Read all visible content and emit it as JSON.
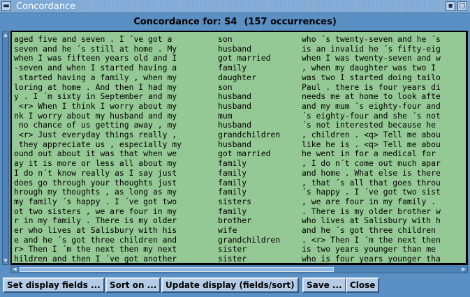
{
  "window": {
    "title": "Concordance"
  },
  "header": {
    "label": "Concordance for: S4",
    "count": "(157 occurrences)"
  },
  "lines": [
    {
      "left": "aged five and seven . I ´ve got a",
      "word": "son",
      "right": "who ´s twenty-seven and he ´s"
    },
    {
      "left": "seven and he ´s still at home . My",
      "word": "husband",
      "right": "is an invalid he ´s fifty-eig"
    },
    {
      "left": "when I was fifteen years old and I",
      "word": "got married",
      "right": "when I was twenty-seven and w"
    },
    {
      "left": "-seven and when I started having a",
      "word": "family",
      "right": ", when my daughter was two I"
    },
    {
      "left": " started having a family , when my",
      "word": "daughter",
      "right": "was two I started doing tailo"
    },
    {
      "left": "loring at home . And then I had my",
      "word": "son",
      "right": "Paul . there is four years di"
    },
    {
      "left": "y . I ´m sixty in September and my",
      "word": "husband",
      "right": "needs me at home to look afte"
    },
    {
      "left": " <r> When I think I worry about my",
      "word": "husband",
      "right": "and my mum ´s eighty-four and"
    },
    {
      "left": "nk I worry about my husband and my",
      "word": "mum",
      "right": "´s eighty-four and she ´s not"
    },
    {
      "left": " no chance of us getting away , my",
      "word": "husband",
      "right": "´s not interested because he"
    },
    {
      "left": " <r> Just everyday things really ,",
      "word": "grandchildren",
      "right": ", children . <q> Tell me abou"
    },
    {
      "left": " they appreciate us , especially my",
      "word": "husband",
      "right": "like he is . <q> Tell me abou"
    },
    {
      "left": "ound out about it was that when we",
      "word": "got married",
      "right": "he went in for a medical for"
    },
    {
      "left": "ay it is more or less all about my",
      "word": "family",
      "right": ", I do n´t come out much apar"
    },
    {
      "left": "I do n´t know really as I say just",
      "word": "family",
      "right": "and home . What else is there"
    },
    {
      "left": "does go through your thoughts just",
      "word": "family",
      "right": ", that ´s all that goes throu"
    },
    {
      "left": "hrough my thoughts , as long as my",
      "word": "family",
      "right": "´s happy . I ´ve got two sist"
    },
    {
      "left": "my family ´s happy . I ´ve got two",
      "word": "sisters",
      "right": ", we are four in my family ."
    },
    {
      "left": "ot two sisters , we are four in my",
      "word": "family",
      "right": ". There is my older brother w"
    },
    {
      "left": "r in my family . There is my older",
      "word": "brother",
      "right": "who lives at Salisbury with h"
    },
    {
      "left": "er who lives at Salisbury with his",
      "word": "wife",
      "right": "and he ´s got three children"
    },
    {
      "left": "e and he ´s got three children and",
      "word": "grandchildren",
      "right": ". <r> Then I ´m the next then"
    },
    {
      "left": "r> Then I ´m the next then my next",
      "word": "sister",
      "right": "is two years younger than me"
    },
    {
      "left": "hildren and then I ´ve got another",
      "word": "sister",
      "right": "who is four years younger tha"
    }
  ],
  "buttons": {
    "set_fields": "Set display fields ...",
    "sort": "Sort on ...",
    "update": "Update display (fields/sort)",
    "save": "Save ...",
    "close": "Close"
  },
  "icons": {
    "menu": "window-menu-icon",
    "minimize": "minimize-icon",
    "maximize": "maximize-icon"
  },
  "colors": {
    "background": "#5b90c4",
    "text_area": "#94c894",
    "title_bar": "#7fa9d6"
  }
}
